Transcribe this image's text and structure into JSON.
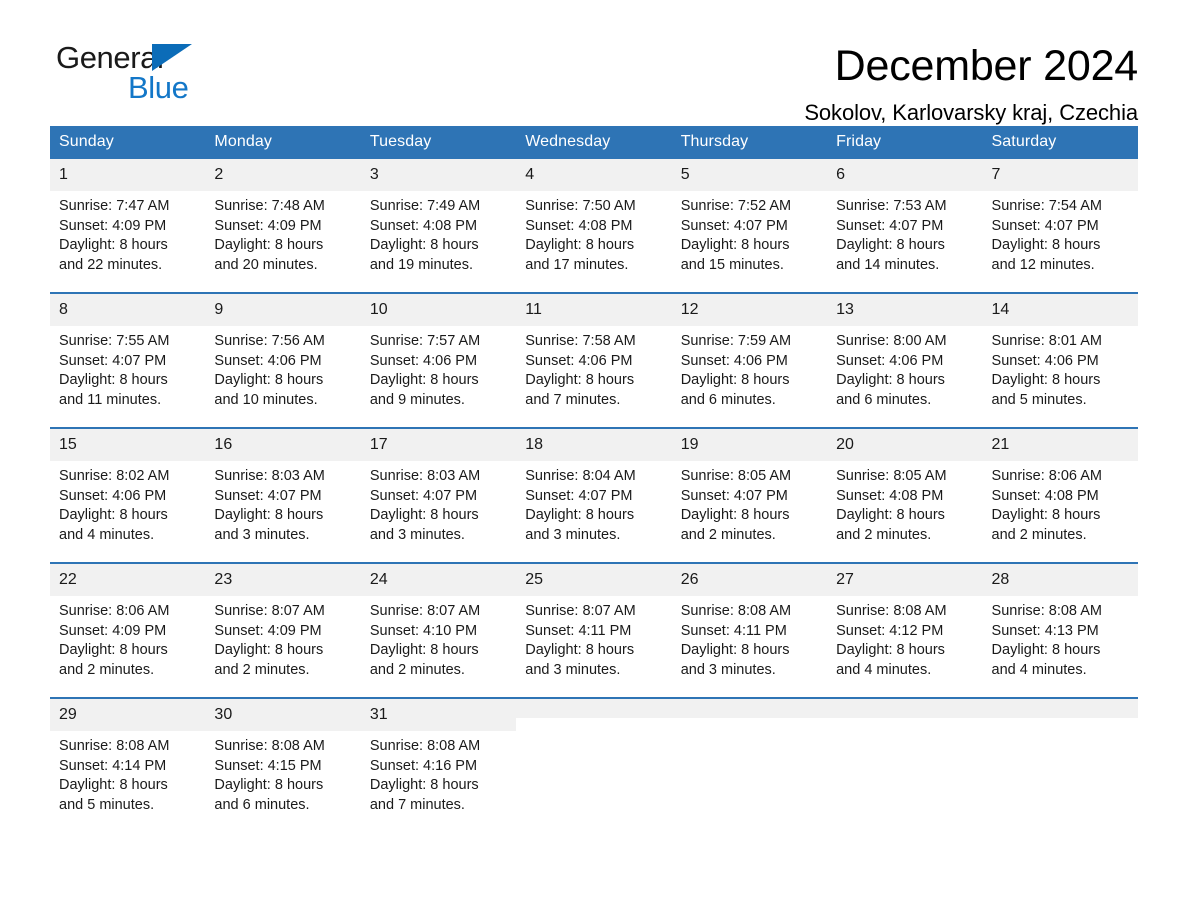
{
  "brand": {
    "name_part1": "General",
    "name_part2": "Blue",
    "triangle_icon": "triangle-logo-icon"
  },
  "header": {
    "month_title": "December 2024",
    "location": "Sokolov, Karlovarsky kraj, Czechia"
  },
  "colors": {
    "header_blue": "#2e74b5",
    "logo_blue": "#1377c8",
    "day_band_gray": "#f1f1f1",
    "text": "#1a1a1a"
  },
  "calendar": {
    "weekday_headers": [
      "Sunday",
      "Monday",
      "Tuesday",
      "Wednesday",
      "Thursday",
      "Friday",
      "Saturday"
    ],
    "weeks": [
      [
        {
          "day": "1",
          "sunrise": "Sunrise: 7:47 AM",
          "sunset": "Sunset: 4:09 PM",
          "daylight_line1": "Daylight: 8 hours",
          "daylight_line2": "and 22 minutes."
        },
        {
          "day": "2",
          "sunrise": "Sunrise: 7:48 AM",
          "sunset": "Sunset: 4:09 PM",
          "daylight_line1": "Daylight: 8 hours",
          "daylight_line2": "and 20 minutes."
        },
        {
          "day": "3",
          "sunrise": "Sunrise: 7:49 AM",
          "sunset": "Sunset: 4:08 PM",
          "daylight_line1": "Daylight: 8 hours",
          "daylight_line2": "and 19 minutes."
        },
        {
          "day": "4",
          "sunrise": "Sunrise: 7:50 AM",
          "sunset": "Sunset: 4:08 PM",
          "daylight_line1": "Daylight: 8 hours",
          "daylight_line2": "and 17 minutes."
        },
        {
          "day": "5",
          "sunrise": "Sunrise: 7:52 AM",
          "sunset": "Sunset: 4:07 PM",
          "daylight_line1": "Daylight: 8 hours",
          "daylight_line2": "and 15 minutes."
        },
        {
          "day": "6",
          "sunrise": "Sunrise: 7:53 AM",
          "sunset": "Sunset: 4:07 PM",
          "daylight_line1": "Daylight: 8 hours",
          "daylight_line2": "and 14 minutes."
        },
        {
          "day": "7",
          "sunrise": "Sunrise: 7:54 AM",
          "sunset": "Sunset: 4:07 PM",
          "daylight_line1": "Daylight: 8 hours",
          "daylight_line2": "and 12 minutes."
        }
      ],
      [
        {
          "day": "8",
          "sunrise": "Sunrise: 7:55 AM",
          "sunset": "Sunset: 4:07 PM",
          "daylight_line1": "Daylight: 8 hours",
          "daylight_line2": "and 11 minutes."
        },
        {
          "day": "9",
          "sunrise": "Sunrise: 7:56 AM",
          "sunset": "Sunset: 4:06 PM",
          "daylight_line1": "Daylight: 8 hours",
          "daylight_line2": "and 10 minutes."
        },
        {
          "day": "10",
          "sunrise": "Sunrise: 7:57 AM",
          "sunset": "Sunset: 4:06 PM",
          "daylight_line1": "Daylight: 8 hours",
          "daylight_line2": "and 9 minutes."
        },
        {
          "day": "11",
          "sunrise": "Sunrise: 7:58 AM",
          "sunset": "Sunset: 4:06 PM",
          "daylight_line1": "Daylight: 8 hours",
          "daylight_line2": "and 7 minutes."
        },
        {
          "day": "12",
          "sunrise": "Sunrise: 7:59 AM",
          "sunset": "Sunset: 4:06 PM",
          "daylight_line1": "Daylight: 8 hours",
          "daylight_line2": "and 6 minutes."
        },
        {
          "day": "13",
          "sunrise": "Sunrise: 8:00 AM",
          "sunset": "Sunset: 4:06 PM",
          "daylight_line1": "Daylight: 8 hours",
          "daylight_line2": "and 6 minutes."
        },
        {
          "day": "14",
          "sunrise": "Sunrise: 8:01 AM",
          "sunset": "Sunset: 4:06 PM",
          "daylight_line1": "Daylight: 8 hours",
          "daylight_line2": "and 5 minutes."
        }
      ],
      [
        {
          "day": "15",
          "sunrise": "Sunrise: 8:02 AM",
          "sunset": "Sunset: 4:06 PM",
          "daylight_line1": "Daylight: 8 hours",
          "daylight_line2": "and 4 minutes."
        },
        {
          "day": "16",
          "sunrise": "Sunrise: 8:03 AM",
          "sunset": "Sunset: 4:07 PM",
          "daylight_line1": "Daylight: 8 hours",
          "daylight_line2": "and 3 minutes."
        },
        {
          "day": "17",
          "sunrise": "Sunrise: 8:03 AM",
          "sunset": "Sunset: 4:07 PM",
          "daylight_line1": "Daylight: 8 hours",
          "daylight_line2": "and 3 minutes."
        },
        {
          "day": "18",
          "sunrise": "Sunrise: 8:04 AM",
          "sunset": "Sunset: 4:07 PM",
          "daylight_line1": "Daylight: 8 hours",
          "daylight_line2": "and 3 minutes."
        },
        {
          "day": "19",
          "sunrise": "Sunrise: 8:05 AM",
          "sunset": "Sunset: 4:07 PM",
          "daylight_line1": "Daylight: 8 hours",
          "daylight_line2": "and 2 minutes."
        },
        {
          "day": "20",
          "sunrise": "Sunrise: 8:05 AM",
          "sunset": "Sunset: 4:08 PM",
          "daylight_line1": "Daylight: 8 hours",
          "daylight_line2": "and 2 minutes."
        },
        {
          "day": "21",
          "sunrise": "Sunrise: 8:06 AM",
          "sunset": "Sunset: 4:08 PM",
          "daylight_line1": "Daylight: 8 hours",
          "daylight_line2": "and 2 minutes."
        }
      ],
      [
        {
          "day": "22",
          "sunrise": "Sunrise: 8:06 AM",
          "sunset": "Sunset: 4:09 PM",
          "daylight_line1": "Daylight: 8 hours",
          "daylight_line2": "and 2 minutes."
        },
        {
          "day": "23",
          "sunrise": "Sunrise: 8:07 AM",
          "sunset": "Sunset: 4:09 PM",
          "daylight_line1": "Daylight: 8 hours",
          "daylight_line2": "and 2 minutes."
        },
        {
          "day": "24",
          "sunrise": "Sunrise: 8:07 AM",
          "sunset": "Sunset: 4:10 PM",
          "daylight_line1": "Daylight: 8 hours",
          "daylight_line2": "and 2 minutes."
        },
        {
          "day": "25",
          "sunrise": "Sunrise: 8:07 AM",
          "sunset": "Sunset: 4:11 PM",
          "daylight_line1": "Daylight: 8 hours",
          "daylight_line2": "and 3 minutes."
        },
        {
          "day": "26",
          "sunrise": "Sunrise: 8:08 AM",
          "sunset": "Sunset: 4:11 PM",
          "daylight_line1": "Daylight: 8 hours",
          "daylight_line2": "and 3 minutes."
        },
        {
          "day": "27",
          "sunrise": "Sunrise: 8:08 AM",
          "sunset": "Sunset: 4:12 PM",
          "daylight_line1": "Daylight: 8 hours",
          "daylight_line2": "and 4 minutes."
        },
        {
          "day": "28",
          "sunrise": "Sunrise: 8:08 AM",
          "sunset": "Sunset: 4:13 PM",
          "daylight_line1": "Daylight: 8 hours",
          "daylight_line2": "and 4 minutes."
        }
      ],
      [
        {
          "day": "29",
          "sunrise": "Sunrise: 8:08 AM",
          "sunset": "Sunset: 4:14 PM",
          "daylight_line1": "Daylight: 8 hours",
          "daylight_line2": "and 5 minutes."
        },
        {
          "day": "30",
          "sunrise": "Sunrise: 8:08 AM",
          "sunset": "Sunset: 4:15 PM",
          "daylight_line1": "Daylight: 8 hours",
          "daylight_line2": "and 6 minutes."
        },
        {
          "day": "31",
          "sunrise": "Sunrise: 8:08 AM",
          "sunset": "Sunset: 4:16 PM",
          "daylight_line1": "Daylight: 8 hours",
          "daylight_line2": "and 7 minutes."
        },
        {
          "day": "",
          "sunrise": "",
          "sunset": "",
          "daylight_line1": "",
          "daylight_line2": ""
        },
        {
          "day": "",
          "sunrise": "",
          "sunset": "",
          "daylight_line1": "",
          "daylight_line2": ""
        },
        {
          "day": "",
          "sunrise": "",
          "sunset": "",
          "daylight_line1": "",
          "daylight_line2": ""
        },
        {
          "day": "",
          "sunrise": "",
          "sunset": "",
          "daylight_line1": "",
          "daylight_line2": ""
        }
      ]
    ]
  }
}
